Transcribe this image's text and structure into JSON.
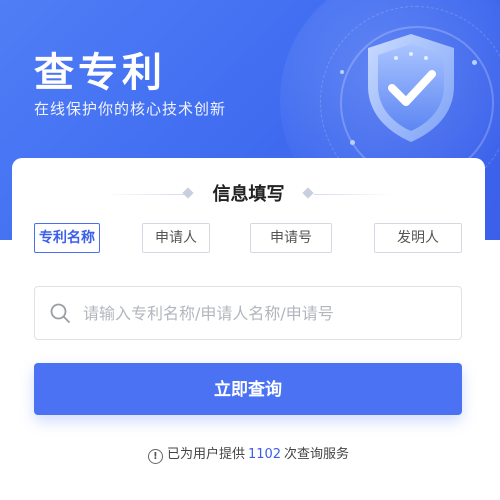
{
  "hero": {
    "title": "查专利",
    "subtitle": "在线保护你的核心技术创新"
  },
  "form": {
    "section_title": "信息填写",
    "tabs": [
      {
        "label": "专利名称",
        "active": true
      },
      {
        "label": "申请人",
        "active": false
      },
      {
        "label": "申请号",
        "active": false
      },
      {
        "label": "发明人",
        "active": false
      }
    ],
    "search": {
      "placeholder": "请输入专利名称/申请人名称/申请号",
      "value": ""
    },
    "submit_label": "立即查询"
  },
  "footer": {
    "info_icon": "!",
    "prefix": "已为用户提供",
    "count": "1102",
    "suffix": "次查询服务"
  },
  "colors": {
    "primary": "#4a72f3",
    "hero_bg": "#3f6bf0"
  },
  "icons": {
    "search": "search-icon",
    "shield": "shield-check-icon",
    "info": "info-icon"
  }
}
